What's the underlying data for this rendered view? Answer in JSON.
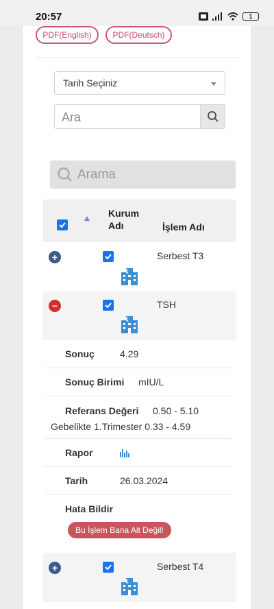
{
  "status_bar": {
    "time": "20:57",
    "battery": "1"
  },
  "pdf_buttons": {
    "english": "PDF(English)",
    "deutsch": "PDF(Deutsch)"
  },
  "filter": {
    "date_select": "Tarih Seçiniz",
    "search_placeholder": "Ara"
  },
  "table": {
    "search_placeholder": "Arama",
    "header": {
      "col_kurum": "Kurum Adı",
      "col_islem": "İşlem Adı"
    },
    "rows": [
      {
        "name": "Serbest T3",
        "expanded": false
      },
      {
        "name": "TSH",
        "expanded": true
      },
      {
        "name": "Serbest T4",
        "expanded": false
      }
    ]
  },
  "detail": {
    "sonuc_label": "Sonuç",
    "sonuc_value": "4.29",
    "birim_label": "Sonuç Birimi",
    "birim_value": "mIU/L",
    "referans_label": "Referans Değeri",
    "referans_value": "0.50 - 5.10",
    "referans_extra": "Gebelikte 1.Trimester 0.33 - 4.59",
    "rapor_label": "Rapor",
    "tarih_label": "Tarih",
    "tarih_value": "26.03.2024",
    "hata_label": "Hata Bildir",
    "hata_button": "Bu İşlem Bana Ait Değil!"
  },
  "colors": {
    "accent": "#1a73e8",
    "pdf_border": "#c85a78",
    "expand": "#3d5a8a",
    "collapse": "#d32f2f",
    "building": "#3a8fd6",
    "report_button": "#c9555e"
  }
}
